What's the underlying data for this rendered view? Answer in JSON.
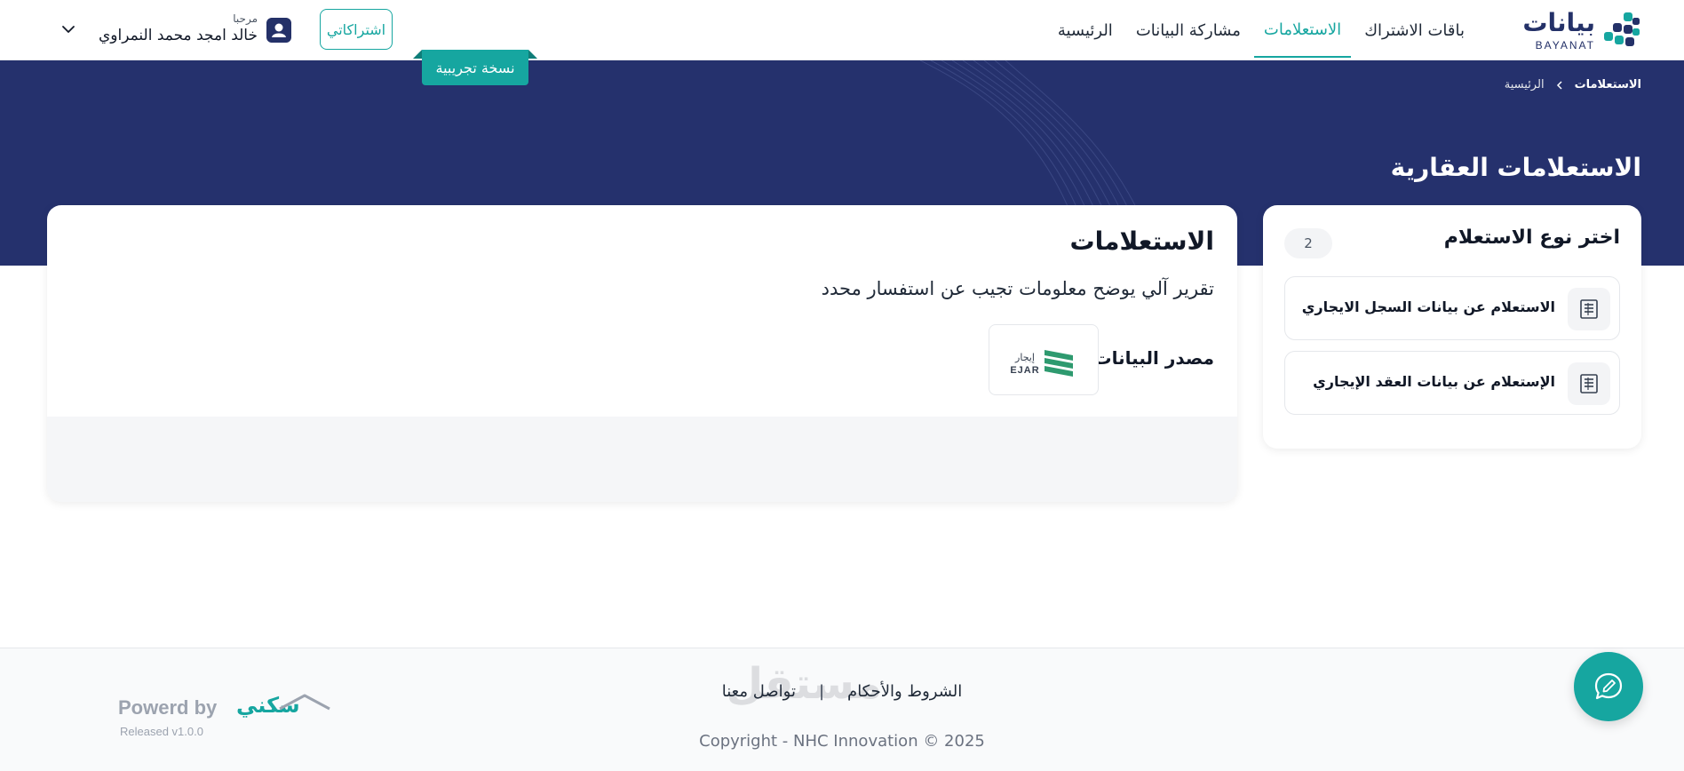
{
  "header": {
    "logo": {
      "text": "بيانات",
      "sub": "BAYANAT"
    },
    "nav": [
      {
        "label": "الرئيسية",
        "active": false
      },
      {
        "label": "مشاركة البيانات",
        "active": false
      },
      {
        "label": "الاستعلامات",
        "active": true
      },
      {
        "label": "باقات الاشتراك",
        "active": false
      }
    ],
    "subscribe_label": "اشتراكاتي",
    "user": {
      "greeting": "مرحبا",
      "name": "خالد امجد محمد النمراوي"
    }
  },
  "banner": {
    "beta_tag": "نسخة تجريبية",
    "breadcrumb": {
      "home": "الرئيسية",
      "current": "الاستعلامات"
    },
    "title": "الاستعلامات العقارية"
  },
  "side_panel": {
    "title": "اختر نوع الاستعلام",
    "count": "2",
    "options": [
      {
        "label": "الاستعلام عن بيانات السجل الايجاري",
        "icon": "document-list-icon"
      },
      {
        "label": "الإستعلام عن بيانات العقد الإيجاري",
        "icon": "document-list-icon"
      }
    ]
  },
  "main_card": {
    "title": "الاستعلامات",
    "description": "تقرير آلي يوضح معلومات تجيب عن استفسار محدد",
    "source_label": "مصدر البيانات",
    "source_logo": {
      "ar": "إيجار",
      "en": "EJAR"
    }
  },
  "footer": {
    "links": [
      "الشروط والأحكام",
      "تواصل معنا"
    ],
    "divider": "|",
    "copyright": "Copyright - NHC Innovation © 2025",
    "powered_by": "Powerd by",
    "powered_brand": "سكني",
    "version": "Released v1.0.0",
    "watermark": "مستقل"
  },
  "colors": {
    "brand_navy": "#25316d",
    "accent_teal": "#16a6a0"
  }
}
